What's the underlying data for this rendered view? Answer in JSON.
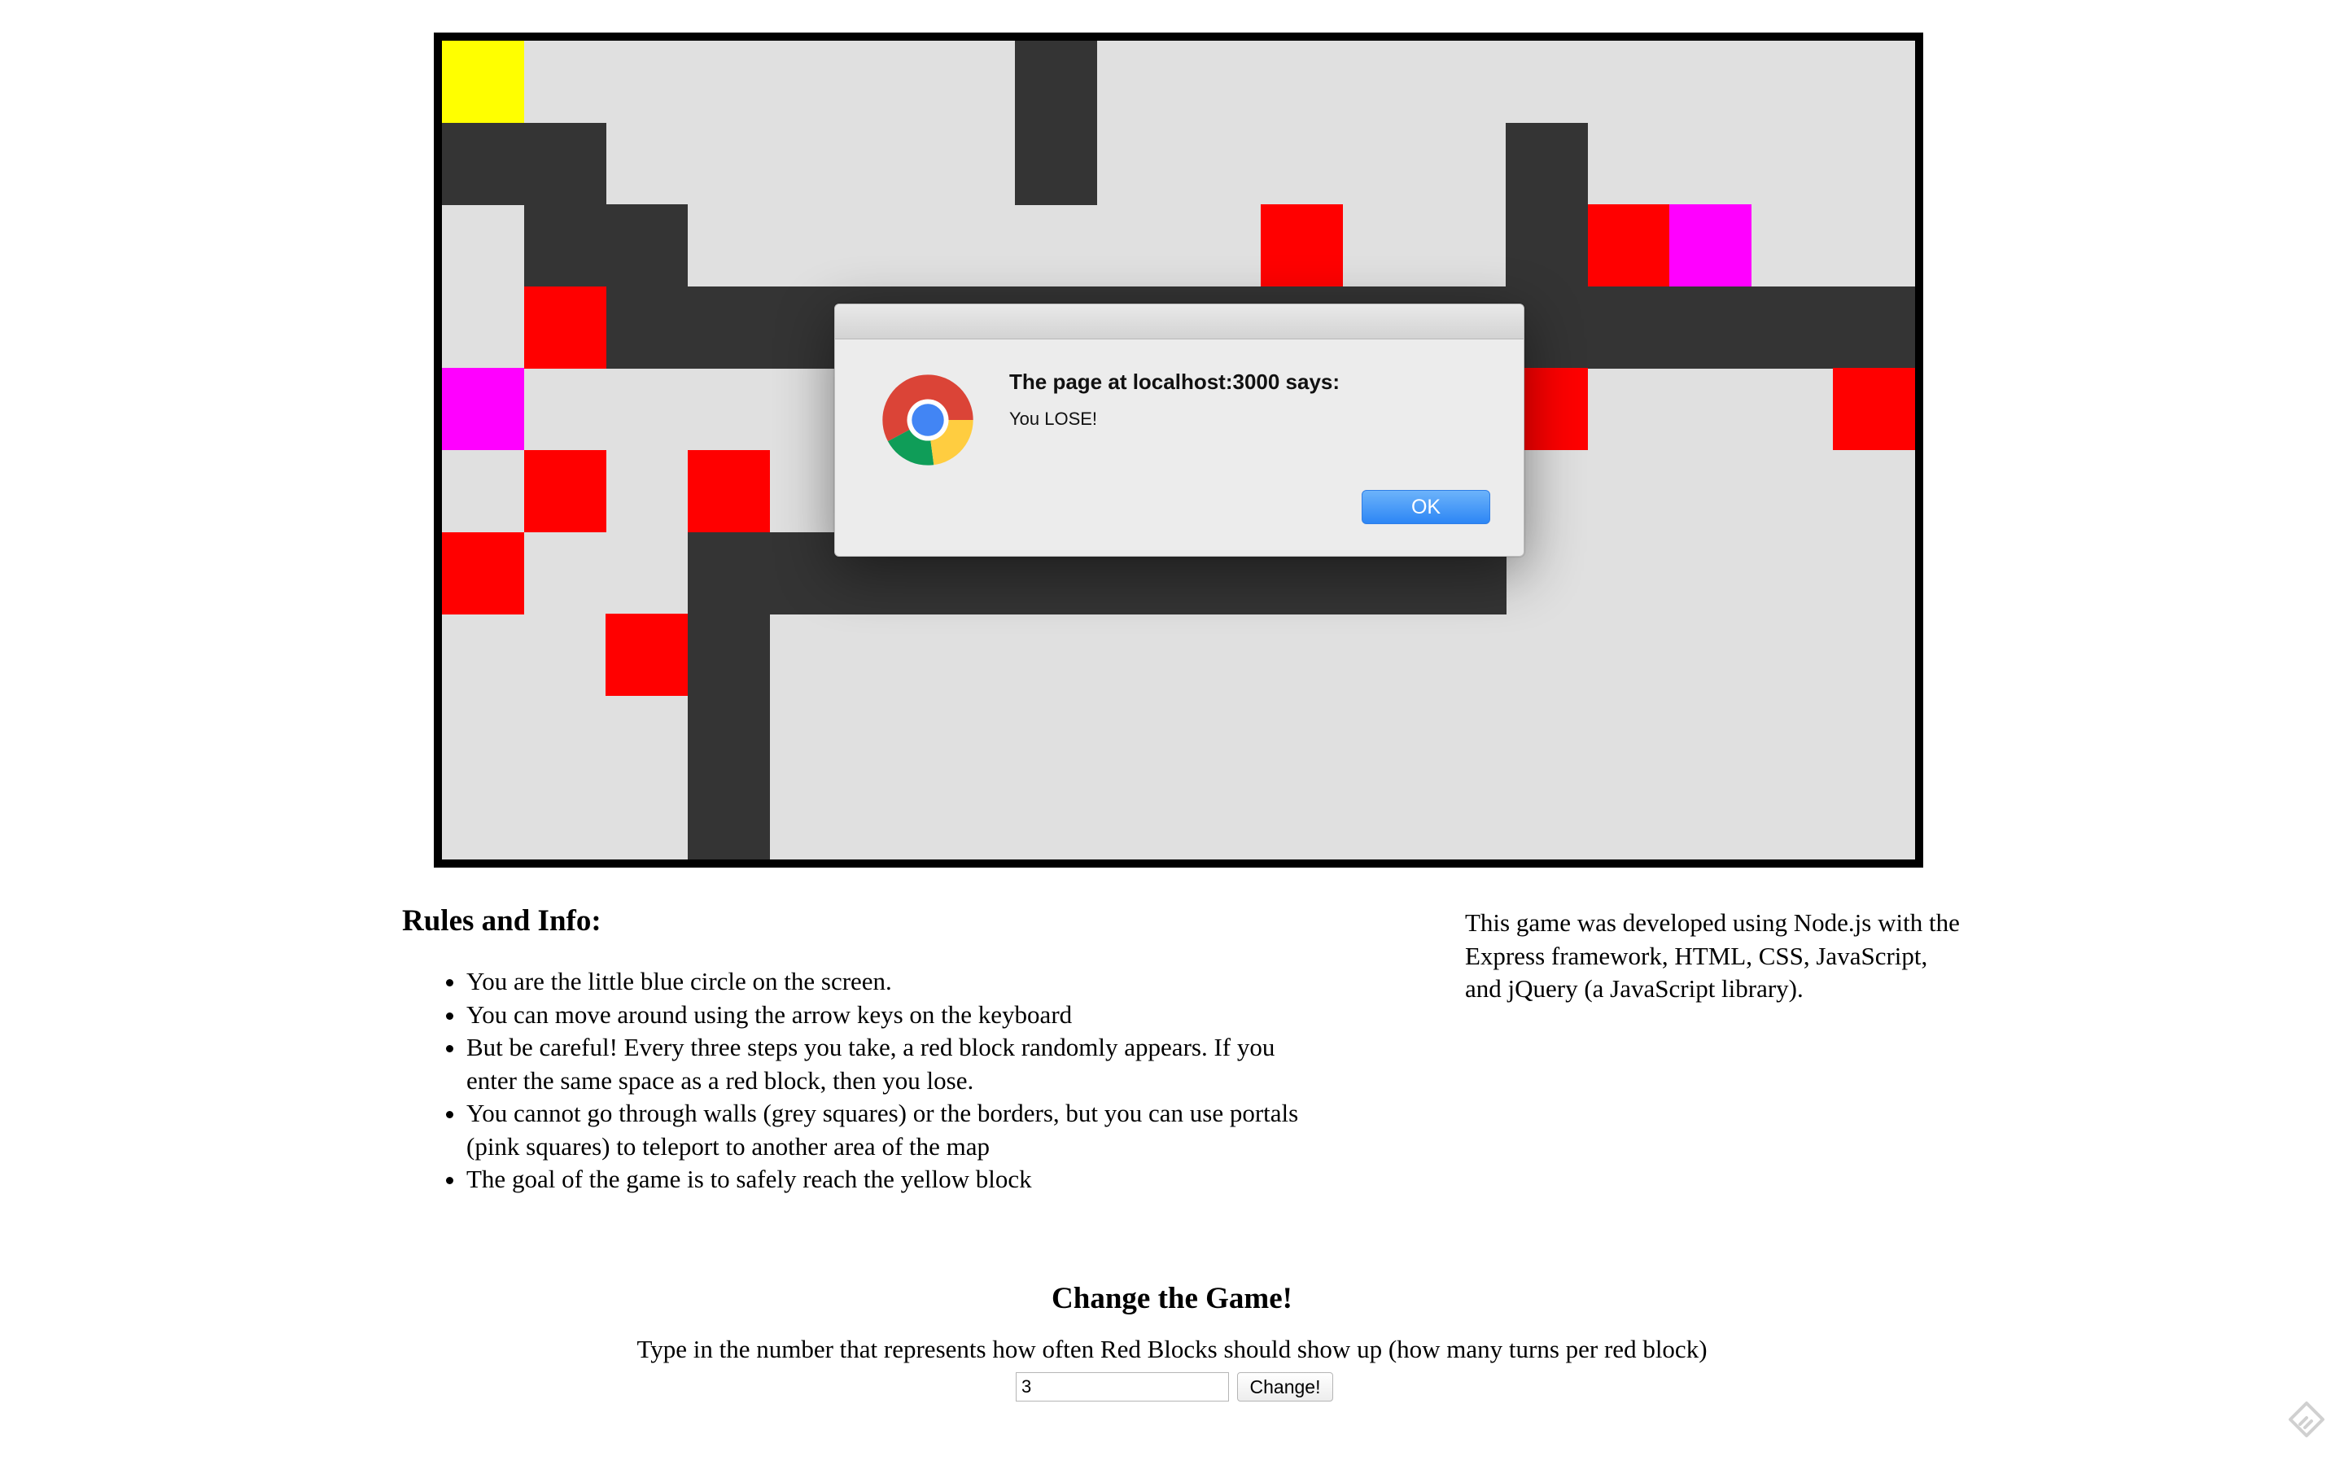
{
  "game": {
    "columns": 18,
    "rows": 10,
    "colors": {
      "floor": "#e0e0e0",
      "wall": "#343434",
      "red_block": "#ff0000",
      "portal": "#ff00ff",
      "goal": "#ffff00",
      "border": "#000000"
    },
    "walls": [
      [
        7,
        0
      ],
      [
        7,
        1
      ],
      [
        0,
        1
      ],
      [
        1,
        1
      ],
      [
        1,
        2
      ],
      [
        2,
        2
      ],
      [
        13,
        1
      ],
      [
        13,
        2
      ],
      [
        2,
        3
      ],
      [
        3,
        3
      ],
      [
        4,
        3
      ],
      [
        5,
        3
      ],
      [
        6,
        3
      ],
      [
        7,
        3
      ],
      [
        8,
        3
      ],
      [
        9,
        3
      ],
      [
        10,
        3
      ],
      [
        11,
        3
      ],
      [
        12,
        3
      ],
      [
        13,
        3
      ],
      [
        14,
        3
      ],
      [
        15,
        3
      ],
      [
        16,
        3
      ],
      [
        17,
        3
      ],
      [
        3,
        6
      ],
      [
        4,
        6
      ],
      [
        5,
        6
      ],
      [
        6,
        6
      ],
      [
        7,
        6
      ],
      [
        8,
        6
      ],
      [
        9,
        6
      ],
      [
        10,
        6
      ],
      [
        11,
        6
      ],
      [
        12,
        6
      ],
      [
        3,
        7
      ],
      [
        3,
        8
      ],
      [
        3,
        9
      ]
    ],
    "red_blocks": [
      [
        10,
        2
      ],
      [
        14,
        2
      ],
      [
        1,
        3
      ],
      [
        13,
        4
      ],
      [
        17,
        4
      ],
      [
        1,
        5
      ],
      [
        3,
        5
      ],
      [
        0,
        6
      ],
      [
        2,
        7
      ]
    ],
    "portals": [
      [
        15,
        2
      ],
      [
        0,
        4
      ]
    ],
    "goal": [
      0,
      0
    ]
  },
  "dialog": {
    "heading": "The page at localhost:3000 says:",
    "message": "You LOSE!",
    "ok_label": "OK"
  },
  "rules": {
    "title": "Rules and Info:",
    "items": [
      "You are the little blue circle on the screen.",
      "You can move around using the arrow keys on the keyboard",
      "But be careful! Every three steps you take, a red block randomly appears. If you enter the same space as a red block, then you lose.",
      "You cannot go through walls (grey squares) or the borders, but you can use portals (pink squares) to teleport to another area of the map",
      "The goal of the game is to safely reach the yellow block"
    ]
  },
  "about": {
    "text": "This game was developed using Node.js with the Express framework, HTML, CSS, JavaScript, and jQuery (a JavaScript library)."
  },
  "change_game": {
    "title": "Change the Game!",
    "description": "Type in the number that represents how often Red Blocks should show up (how many turns per red block)",
    "input_value": "3",
    "button_label": "Change!"
  },
  "icons": {
    "dialog_logo": "chrome-logo-icon",
    "corner": "feedly-icon"
  }
}
